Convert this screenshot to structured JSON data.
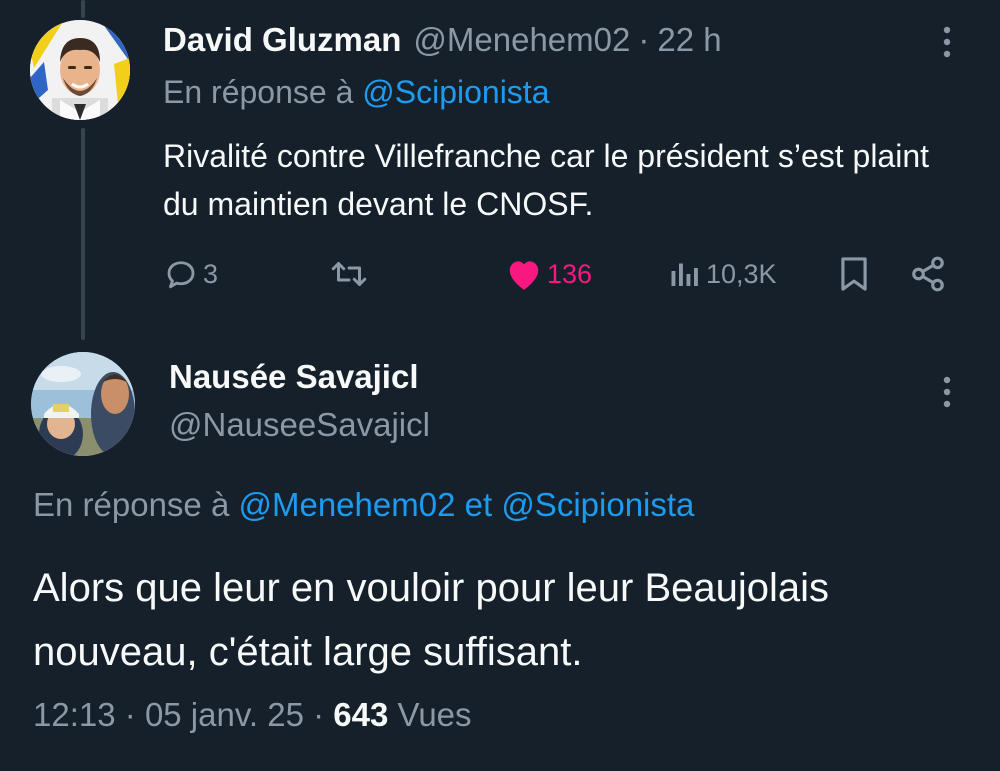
{
  "tweet1": {
    "author_name": "David Gluzman",
    "handle": "@Menehem02",
    "separator": "·",
    "time": "22 h",
    "reply_prefix": "En réponse à",
    "reply_to": "@Scipionista",
    "text": "Rivalité contre Villefranche car le président s’est plaint du maintien devant le CNOSF.",
    "actions": {
      "replies": "3",
      "retweets": "",
      "likes": "136",
      "views": "10,3K"
    },
    "icons": [
      "reply-icon",
      "retweet-icon",
      "heart-icon",
      "views-icon",
      "bookmark-icon",
      "share-icon"
    ],
    "like_color": "#f91880"
  },
  "tweet2": {
    "author_name": "Nausée Savajicl",
    "handle": "@NauseeSavajicl",
    "reply_prefix": "En réponse à",
    "reply_to_1": "@Menehem02",
    "reply_joiner": "et",
    "reply_to_2": "@Scipionista",
    "text": "Alors que leur en vouloir pour leur Beaujolais nouveau, c'était large suffisant.",
    "time": "12:13",
    "sep1": "·",
    "date": "05 janv. 25",
    "sep2": "·",
    "views_count": "643",
    "views_label": "Vues"
  },
  "colors": {
    "background": "#15202b",
    "primary_text": "#f7f9f9",
    "secondary_text": "#8b98a5",
    "link": "#1d9bf0",
    "like": "#f91880"
  }
}
